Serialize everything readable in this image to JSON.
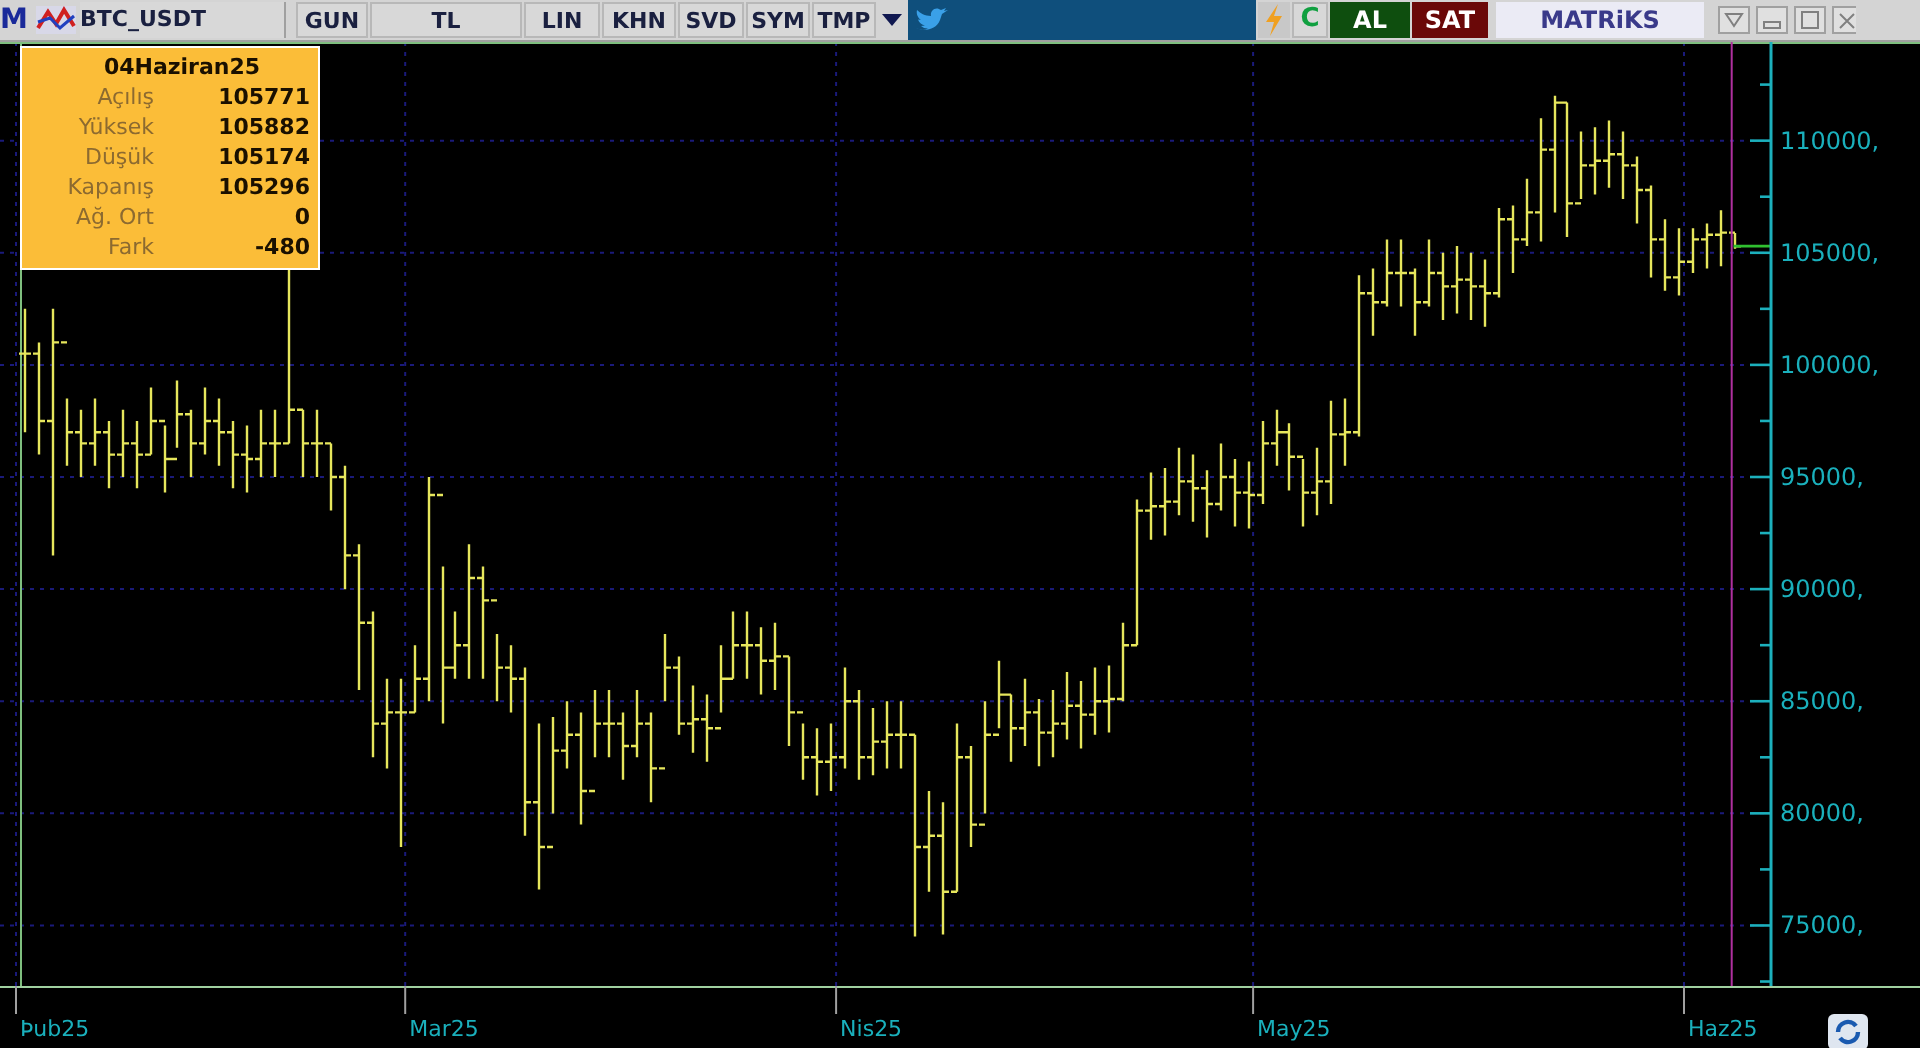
{
  "toolbar": {
    "logo": "M",
    "symbol": "BTC_USDT",
    "buttons": [
      "GUN",
      "TL",
      "LIN",
      "KHN",
      "SVD",
      "SYM",
      "TMP"
    ],
    "actions": [
      {
        "label": "C",
        "kind": "refresh"
      },
      {
        "label": "AL",
        "kind": "buy"
      },
      {
        "label": "SAT",
        "kind": "sell"
      }
    ],
    "brand": "MATRiKS"
  },
  "info_box": {
    "title": "04Haziran25",
    "rows": [
      {
        "label": "Açılış",
        "value": "105771"
      },
      {
        "label": "Yüksek",
        "value": "105882"
      },
      {
        "label": "Düşük",
        "value": "105174"
      },
      {
        "label": "Kapanış",
        "value": "105296"
      },
      {
        "label": "Ağ. Ort",
        "value": "0"
      },
      {
        "label": "Fark",
        "value": "-480"
      }
    ]
  },
  "chart": {
    "y_axis_labels": [
      "110000,",
      "105000,",
      "100000,",
      "95000,",
      "90000,",
      "85000,",
      "80000,",
      "75000,"
    ],
    "x_axis_labels": [
      "Þub25",
      "Mar25",
      "Nis25",
      "May25",
      "Haz25"
    ]
  }
}
